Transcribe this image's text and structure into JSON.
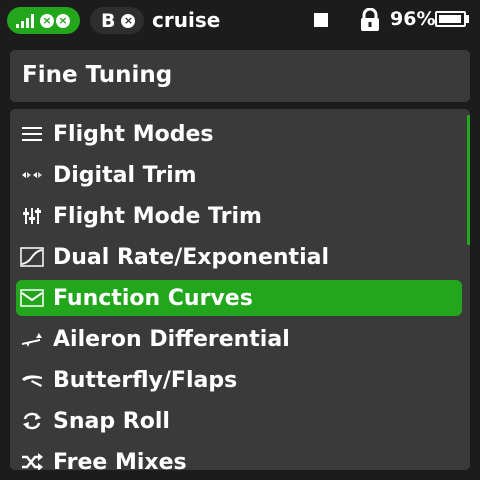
{
  "status": {
    "model_name": "cruise",
    "receiver_letter": "B",
    "battery_percent": "96%",
    "battery_level": 0.96
  },
  "header": {
    "title": "Fine Tuning"
  },
  "menu": {
    "selected_index": 4,
    "items": [
      {
        "label": "Flight Modes",
        "icon": "list-icon"
      },
      {
        "label": "Digital Trim",
        "icon": "arrows-icon"
      },
      {
        "label": "Flight Mode Trim",
        "icon": "sliders-icon"
      },
      {
        "label": "Dual Rate/Exponential",
        "icon": "expo-curve-icon"
      },
      {
        "label": "Function Curves",
        "icon": "function-curve-icon"
      },
      {
        "label": "Aileron Differential",
        "icon": "aileron-icon"
      },
      {
        "label": "Butterfly/Flaps",
        "icon": "wing-flap-icon"
      },
      {
        "label": "Snap Roll",
        "icon": "roll-icon"
      },
      {
        "label": "Free Mixes",
        "icon": "shuffle-icon"
      }
    ]
  },
  "colors": {
    "accent": "#22a61c",
    "background": "#1c1c1c",
    "panel": "#3a3a3a"
  }
}
